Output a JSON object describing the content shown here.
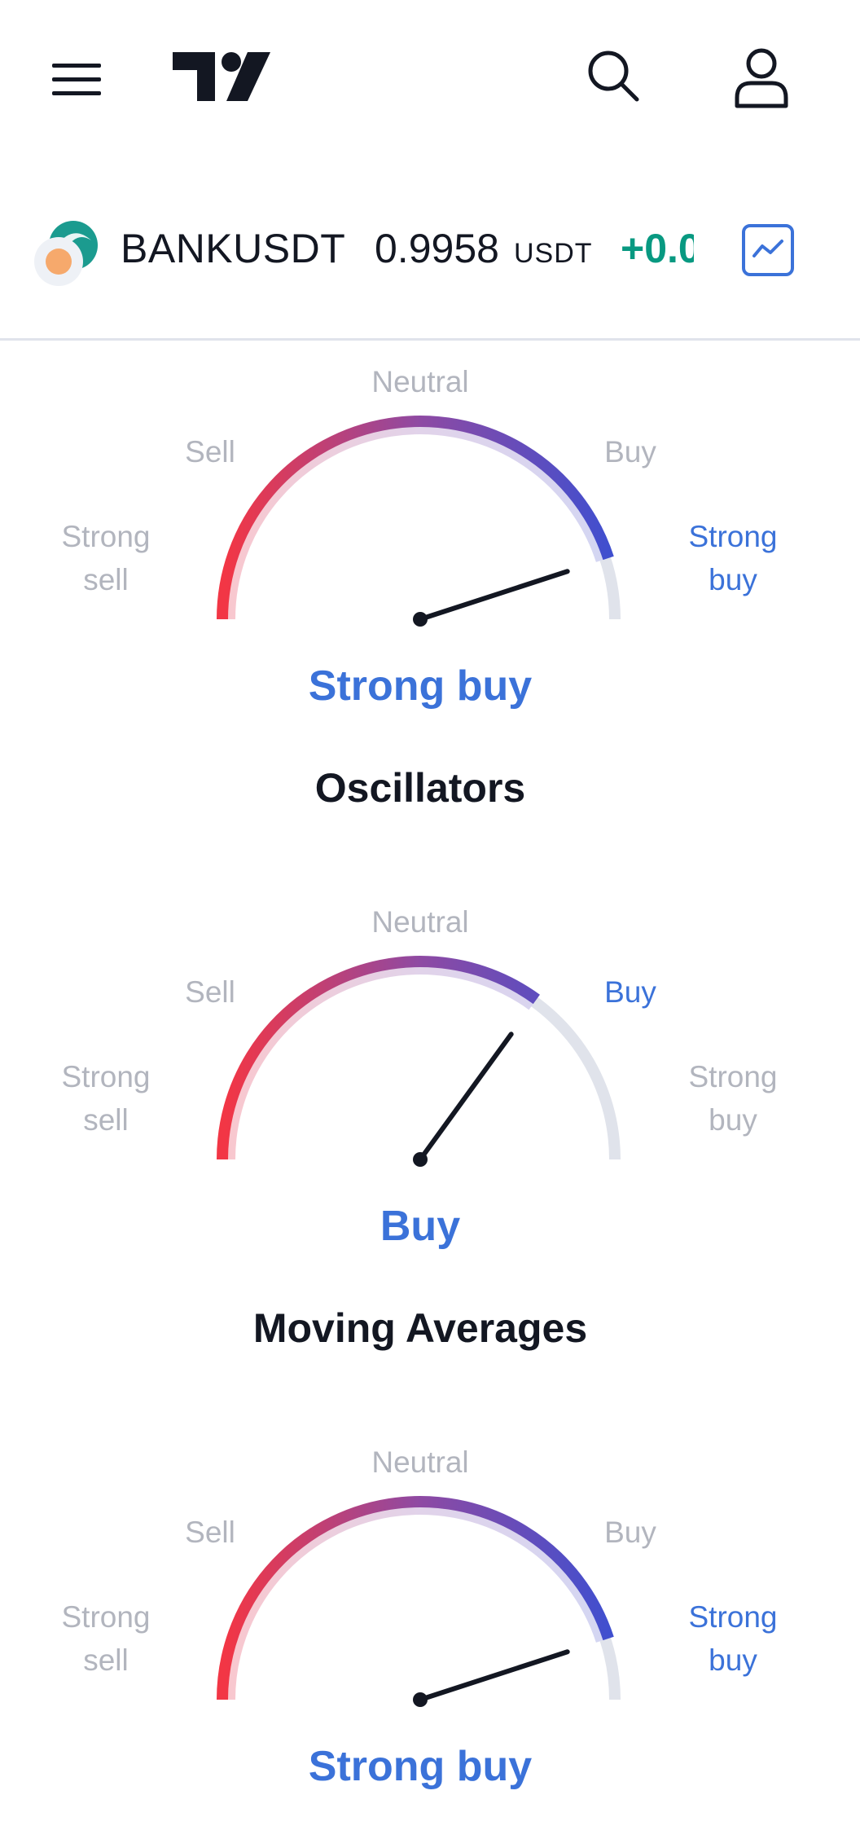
{
  "header": {
    "menu_icon": "hamburger-menu-icon",
    "logo_icon": "tradingview-logo-icon",
    "search_icon": "search-icon",
    "user_icon": "user-profile-icon"
  },
  "symbol": {
    "name": "BANKUSDT",
    "price": "0.9958",
    "currency": "USDT",
    "change": "+0.0",
    "chart_icon": "chart-line-icon",
    "logo_icon": "coin-logo-icon"
  },
  "colors": {
    "accent": "#3b72d9",
    "gauge_red": "#f23645",
    "gauge_purple": "#8e4aa3",
    "gauge_blue": "#3e4fd0",
    "muted": "#b2b5be",
    "positive": "#089981"
  },
  "gauges": [
    {
      "title": "",
      "labels": {
        "neutral": "Neutral",
        "sell": "Sell",
        "buy": "Buy",
        "strong_sell": "Strong sell",
        "strong_buy": "Strong buy"
      },
      "active": "strong_buy",
      "summary": "Strong buy",
      "needle_fraction": 0.9
    },
    {
      "title": "Oscillators",
      "labels": {
        "neutral": "Neutral",
        "sell": "Sell",
        "buy": "Buy",
        "strong_sell": "Strong sell",
        "strong_buy": "Strong buy"
      },
      "active": "buy",
      "summary": "Buy",
      "needle_fraction": 0.7
    },
    {
      "title": "Moving Averages",
      "labels": {
        "neutral": "Neutral",
        "sell": "Sell",
        "buy": "Buy",
        "strong_sell": "Strong sell",
        "strong_buy": "Strong buy"
      },
      "active": "strong_buy",
      "summary": "Strong buy",
      "needle_fraction": 0.9
    }
  ]
}
